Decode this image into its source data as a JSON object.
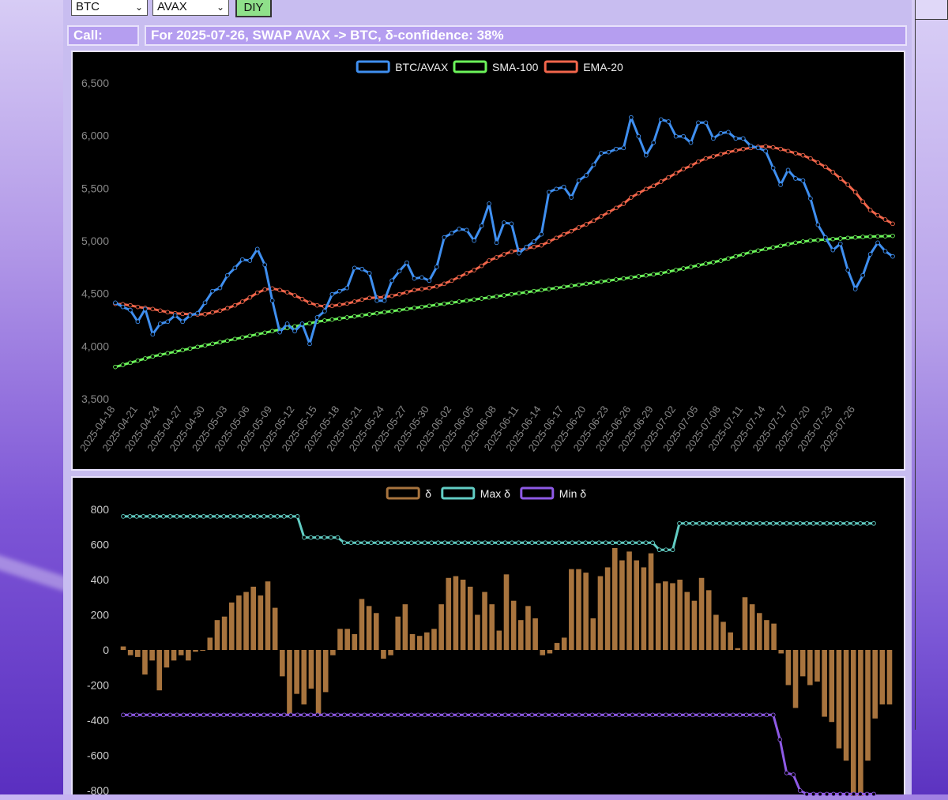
{
  "controls": {
    "select1": "BTC",
    "select2": "AVAX",
    "diy_label": "DIY"
  },
  "call": {
    "label": "Call:",
    "text": "For 2025-07-26, SWAP AVAX -> BTC, δ-confidence: 38%"
  },
  "colors": {
    "btc_avax": "#3f8ff0",
    "sma": "#6cf55a",
    "ema": "#f2664b",
    "delta_bar": "#a8743e",
    "max_delta": "#62cdc4",
    "min_delta": "#8e5ae6"
  },
  "chart_data": [
    {
      "type": "line",
      "legend": [
        "BTC/AVAX",
        "SMA-100",
        "EMA-20"
      ],
      "ylim": [
        3500,
        6500
      ],
      "yticks": [
        "6,500",
        "6,000",
        "5,500",
        "5,000",
        "4,500",
        "4,000",
        "3,500"
      ],
      "start_date": "2025-04-18",
      "xtick_labels": [
        "2025-04-18",
        "2025-04-21",
        "2025-04-24",
        "2025-04-27",
        "2025-04-30",
        "2025-05-03",
        "2025-05-06",
        "2025-05-09",
        "2025-05-12",
        "2025-05-15",
        "2025-05-18",
        "2025-05-21",
        "2025-05-24",
        "2025-05-27",
        "2025-05-30",
        "2025-06-02",
        "2025-06-05",
        "2025-06-08",
        "2025-06-11",
        "2025-06-14",
        "2025-06-17",
        "2025-06-20",
        "2025-06-23",
        "2025-06-26",
        "2025-06-29",
        "2025-07-02",
        "2025-07-05",
        "2025-07-08",
        "2025-07-11",
        "2025-07-14",
        "2025-07-17",
        "2025-07-20",
        "2025-07-23",
        "2025-07-26"
      ],
      "series": [
        {
          "name": "BTC/AVAX",
          "values": [
            4420,
            4380,
            4350,
            4240,
            4360,
            4120,
            4220,
            4240,
            4300,
            4240,
            4300,
            4320,
            4420,
            4530,
            4560,
            4680,
            4750,
            4830,
            4820,
            4930,
            4780,
            4440,
            4140,
            4220,
            4150,
            4220,
            4030,
            4280,
            4340,
            4500,
            4530,
            4560,
            4750,
            4740,
            4700,
            4440,
            4440,
            4630,
            4720,
            4800,
            4650,
            4660,
            4630,
            4760,
            5040,
            5080,
            5120,
            5110,
            5010,
            5150,
            5360,
            4990,
            5180,
            5170,
            4890,
            4950,
            5000,
            5070,
            5470,
            5500,
            5520,
            5420,
            5580,
            5630,
            5730,
            5840,
            5850,
            5880,
            5890,
            6180,
            6000,
            5820,
            5940,
            6160,
            6140,
            6000,
            6000,
            5940,
            6130,
            6130,
            5980,
            6030,
            6040,
            5980,
            5980,
            5910,
            5890,
            5860,
            5700,
            5540,
            5680,
            5600,
            5580,
            5410,
            5160,
            5040,
            4920,
            4980,
            4730,
            4550,
            4680,
            4880,
            4990,
            4910,
            4860
          ]
        },
        {
          "name": "SMA-100",
          "values": [
            3810,
            3830,
            3850,
            3870,
            3890,
            3910,
            3925,
            3940,
            3955,
            3970,
            3985,
            4000,
            4015,
            4030,
            4045,
            4060,
            4075,
            4090,
            4105,
            4120,
            4135,
            4150,
            4165,
            4180,
            4195,
            4210,
            4225,
            4240,
            4250,
            4260,
            4270,
            4280,
            4290,
            4300,
            4310,
            4320,
            4330,
            4340,
            4350,
            4360,
            4370,
            4380,
            4390,
            4400,
            4410,
            4420,
            4430,
            4440,
            4450,
            4460,
            4470,
            4480,
            4490,
            4500,
            4510,
            4520,
            4530,
            4540,
            4550,
            4560,
            4570,
            4580,
            4590,
            4600,
            4610,
            4620,
            4630,
            4640,
            4650,
            4660,
            4670,
            4680,
            4690,
            4700,
            4715,
            4730,
            4745,
            4760,
            4775,
            4790,
            4805,
            4820,
            4840,
            4860,
            4880,
            4900,
            4915,
            4930,
            4945,
            4960,
            4975,
            4990,
            5000,
            5010,
            5015,
            5020,
            5025,
            5030,
            5035,
            5040,
            5045,
            5048,
            5050,
            5052,
            5055
          ]
        },
        {
          "name": "EMA-20",
          "values": [
            4410,
            4405,
            4395,
            4380,
            4370,
            4360,
            4345,
            4330,
            4320,
            4315,
            4310,
            4308,
            4312,
            4328,
            4345,
            4368,
            4395,
            4430,
            4470,
            4515,
            4545,
            4555,
            4540,
            4520,
            4490,
            4455,
            4420,
            4395,
            4385,
            4390,
            4400,
            4412,
            4430,
            4450,
            4465,
            4470,
            4475,
            4485,
            4500,
            4520,
            4540,
            4550,
            4560,
            4575,
            4600,
            4630,
            4665,
            4700,
            4730,
            4770,
            4820,
            4850,
            4880,
            4905,
            4920,
            4935,
            4950,
            4965,
            5000,
            5035,
            5070,
            5100,
            5135,
            5165,
            5200,
            5240,
            5280,
            5320,
            5360,
            5420,
            5460,
            5500,
            5530,
            5570,
            5610,
            5650,
            5690,
            5720,
            5760,
            5790,
            5810,
            5830,
            5850,
            5865,
            5880,
            5890,
            5900,
            5905,
            5895,
            5880,
            5860,
            5840,
            5820,
            5790,
            5750,
            5710,
            5660,
            5600,
            5540,
            5470,
            5380,
            5300,
            5250,
            5210,
            5170
          ]
        }
      ]
    },
    {
      "type": "bar",
      "legend": [
        "δ",
        "Max δ",
        "Min δ"
      ],
      "ylim": [
        -800,
        800
      ],
      "yticks": [
        "800",
        "600",
        "400",
        "200",
        "0",
        "-200",
        "-400",
        "-600",
        "-800"
      ],
      "series": [
        {
          "name": "δ",
          "values": [
            20,
            -30,
            -40,
            -140,
            -60,
            -230,
            -100,
            -60,
            -30,
            -60,
            -10,
            0,
            70,
            170,
            190,
            270,
            310,
            330,
            360,
            310,
            390,
            240,
            -150,
            -370,
            -250,
            -310,
            -220,
            -370,
            -240,
            -30,
            120,
            120,
            90,
            290,
            250,
            210,
            -50,
            -30,
            190,
            260,
            90,
            80,
            100,
            120,
            260,
            410,
            420,
            400,
            360,
            200,
            330,
            260,
            110,
            430,
            280,
            170,
            250,
            180,
            -30,
            -20,
            40,
            70,
            460,
            460,
            440,
            180,
            420,
            470,
            580,
            510,
            560,
            510,
            470,
            550,
            380,
            390,
            380,
            400,
            330,
            280,
            410,
            340,
            200,
            160,
            100,
            10,
            300,
            260,
            210,
            170,
            150,
            -20,
            -200,
            -330,
            -150,
            -200,
            -180,
            -380,
            -410,
            -560,
            -630,
            -850,
            -970,
            -630,
            -390,
            -310,
            -310
          ]
        },
        {
          "name": "Max δ",
          "values": [
            760,
            760,
            760,
            760,
            760,
            760,
            760,
            760,
            760,
            760,
            760,
            760,
            760,
            760,
            760,
            760,
            760,
            760,
            760,
            760,
            760,
            760,
            760,
            760,
            760,
            760,
            760,
            640,
            640,
            640,
            640,
            640,
            640,
            610,
            610,
            610,
            610,
            610,
            610,
            610,
            610,
            610,
            610,
            610,
            610,
            610,
            610,
            610,
            610,
            610,
            610,
            610,
            610,
            610,
            610,
            610,
            610,
            610,
            610,
            610,
            610,
            610,
            610,
            610,
            610,
            610,
            610,
            610,
            610,
            610,
            610,
            610,
            610,
            610,
            610,
            610,
            610,
            610,
            610,
            610,
            570,
            570,
            570,
            720,
            720,
            720,
            720,
            720,
            720,
            720,
            720,
            720,
            720,
            720,
            720,
            720,
            720,
            720,
            720,
            720,
            720,
            720,
            720,
            720,
            720,
            720,
            720,
            720,
            720,
            720,
            720,
            720,
            720
          ]
        },
        {
          "name": "Min δ",
          "values": [
            -370,
            -370,
            -370,
            -370,
            -370,
            -370,
            -370,
            -370,
            -370,
            -370,
            -370,
            -370,
            -370,
            -370,
            -370,
            -370,
            -370,
            -370,
            -370,
            -370,
            -370,
            -370,
            -370,
            -370,
            -370,
            -370,
            -370,
            -370,
            -370,
            -370,
            -370,
            -370,
            -370,
            -370,
            -370,
            -370,
            -370,
            -370,
            -370,
            -370,
            -370,
            -370,
            -370,
            -370,
            -370,
            -370,
            -370,
            -370,
            -370,
            -370,
            -370,
            -370,
            -370,
            -370,
            -370,
            -370,
            -370,
            -370,
            -370,
            -370,
            -370,
            -370,
            -370,
            -370,
            -370,
            -370,
            -370,
            -370,
            -370,
            -370,
            -370,
            -370,
            -370,
            -370,
            -370,
            -370,
            -370,
            -370,
            -370,
            -370,
            -370,
            -370,
            -370,
            -370,
            -370,
            -370,
            -370,
            -370,
            -370,
            -370,
            -370,
            -370,
            -370,
            -370,
            -370,
            -370,
            -370,
            -370,
            -510,
            -700,
            -710,
            -800,
            -820,
            -820,
            -820,
            -820,
            -820,
            -820,
            -820,
            -820,
            -820,
            -820,
            -820
          ]
        }
      ]
    }
  ]
}
